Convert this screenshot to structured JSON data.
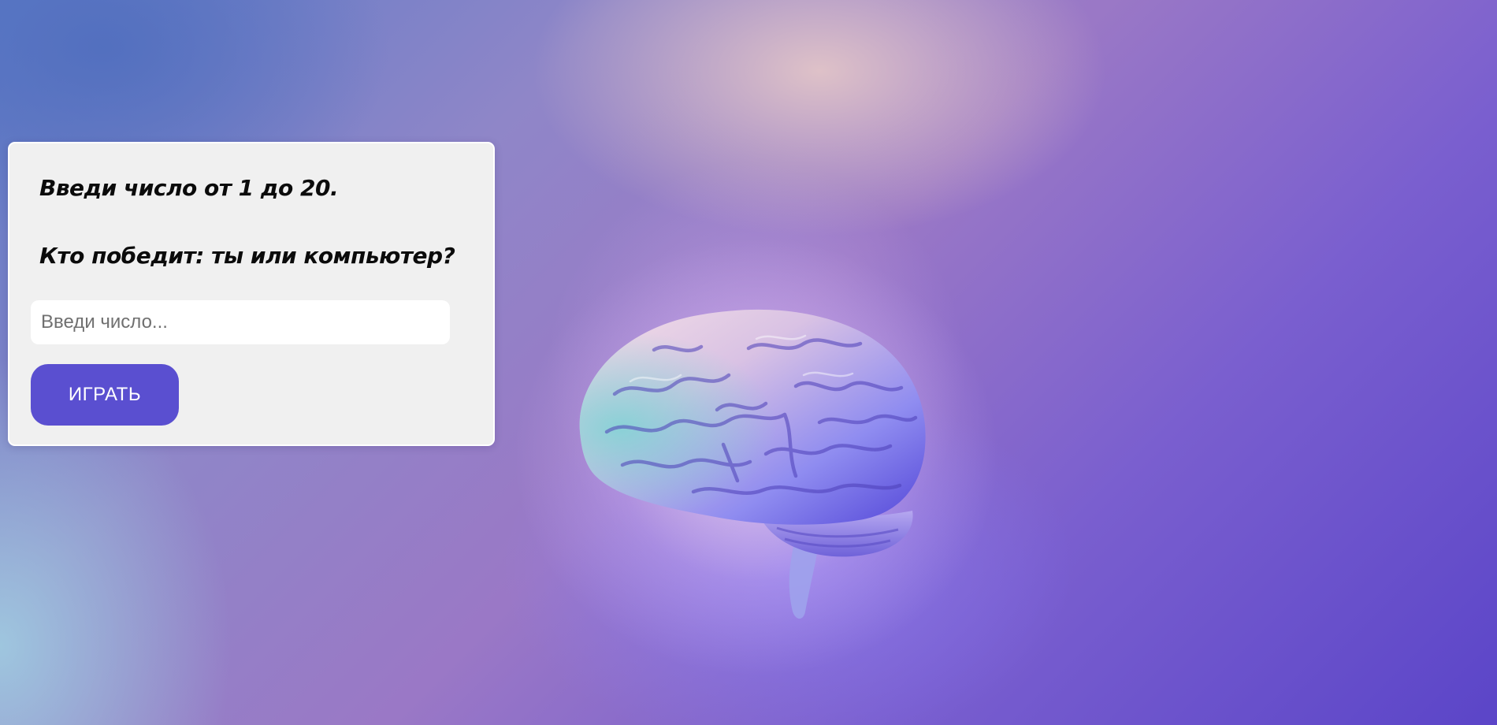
{
  "game": {
    "line1": "Введи число от 1 до 20.",
    "line2": "Кто победит: ты или компьютер?",
    "input_placeholder": "Введи число...",
    "input_value": "",
    "play_label": "ИГРАТЬ"
  },
  "colors": {
    "card_bg": "#f0f0f0",
    "button_bg": "#5a4fd0",
    "button_text": "#ffffff"
  },
  "icons": {
    "hero": "brain-icon"
  }
}
